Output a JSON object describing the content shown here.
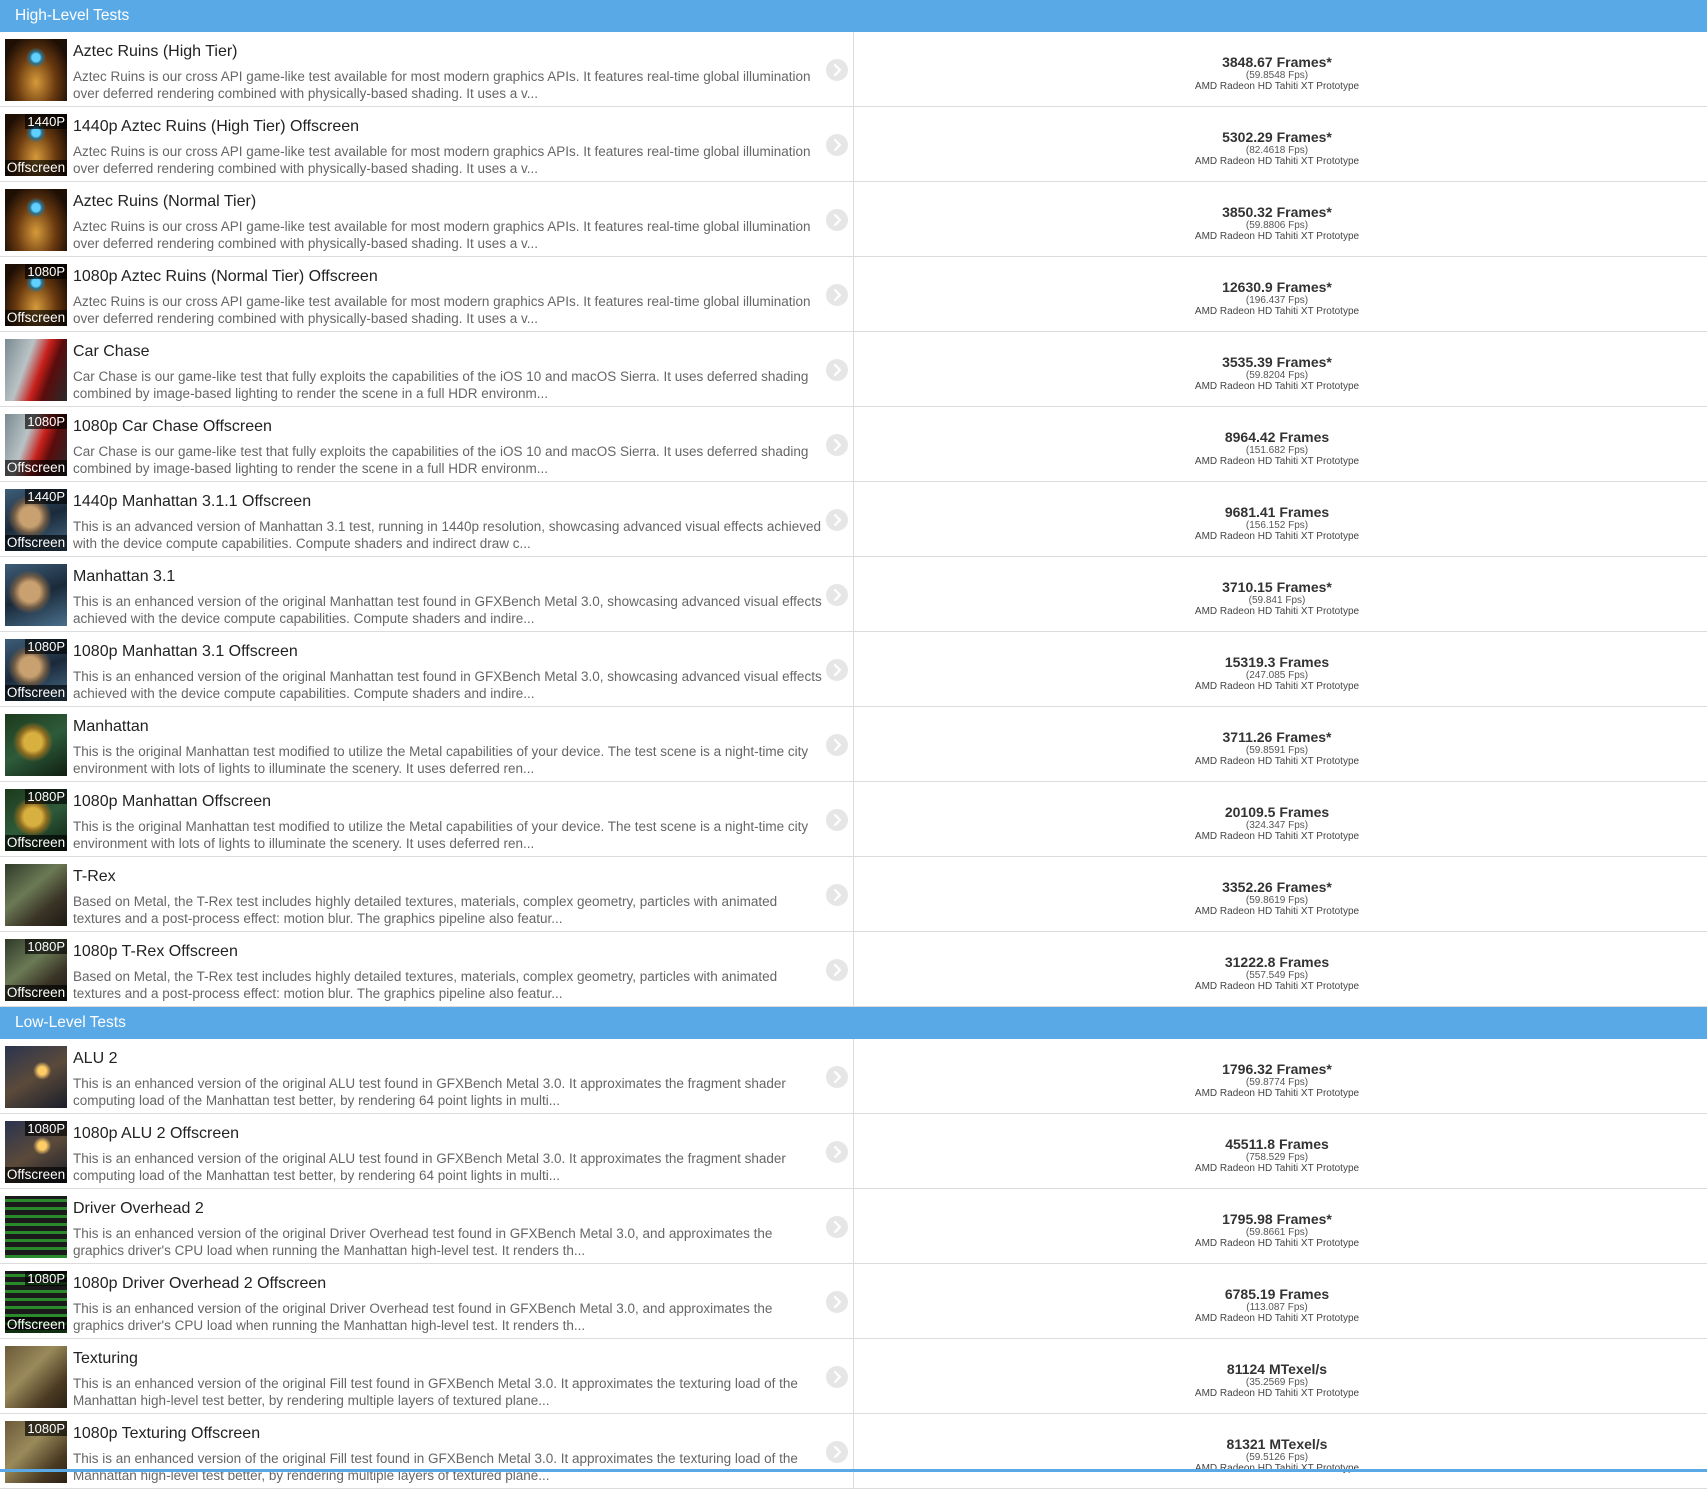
{
  "colors": {
    "header": "#58a9e6",
    "row_border": "#dcdcdc",
    "title": "#222222",
    "desc": "#666666"
  },
  "sections": [
    {
      "title": "High-Level Tests",
      "rows": [
        {
          "name": "Aztec Ruins (High Tier)",
          "thumb": "aztec",
          "badge_top": "",
          "badge_bottom": "",
          "desc": "Aztec Ruins is our cross API game-like test available for most modern graphics APIs. It features real-time global illumination over deferred rendering combined with physically-based shading. It uses a v...",
          "frames": "3848.67 Frames*",
          "fps": "(59.8548 Fps)",
          "device": "AMD Radeon HD Tahiti XT Prototype"
        },
        {
          "name": "1440p Aztec Ruins (High Tier) Offscreen",
          "thumb": "aztec",
          "badge_top": "1440P",
          "badge_bottom": "Offscreen",
          "desc": "Aztec Ruins is our cross API game-like test available for most modern graphics APIs. It features real-time global illumination over deferred rendering combined with physically-based shading. It uses a v...",
          "frames": "5302.29 Frames*",
          "fps": "(82.4618 Fps)",
          "device": "AMD Radeon HD Tahiti XT Prototype"
        },
        {
          "name": "Aztec Ruins (Normal Tier)",
          "thumb": "aztec",
          "badge_top": "",
          "badge_bottom": "",
          "desc": "Aztec Ruins is our cross API game-like test available for most modern graphics APIs. It features real-time global illumination over deferred rendering combined with physically-based shading. It uses a v...",
          "frames": "3850.32 Frames*",
          "fps": "(59.8806 Fps)",
          "device": "AMD Radeon HD Tahiti XT Prototype"
        },
        {
          "name": "1080p Aztec Ruins (Normal Tier) Offscreen",
          "thumb": "aztec",
          "badge_top": "1080P",
          "badge_bottom": "Offscreen",
          "desc": "Aztec Ruins is our cross API game-like test available for most modern graphics APIs. It features real-time global illumination over deferred rendering combined with physically-based shading. It uses a v...",
          "frames": "12630.9 Frames*",
          "fps": "(196.437 Fps)",
          "device": "AMD Radeon HD Tahiti XT Prototype"
        },
        {
          "name": "Car Chase",
          "thumb": "car",
          "badge_top": "",
          "badge_bottom": "",
          "desc": "Car Chase is our game-like test that fully exploits the capabilities of the iOS 10 and macOS Sierra. It uses deferred shading combined by image-based lighting to render the scene in a full HDR environm...",
          "frames": "3535.39 Frames*",
          "fps": "(59.8204 Fps)",
          "device": "AMD Radeon HD Tahiti XT Prototype"
        },
        {
          "name": "1080p Car Chase Offscreen",
          "thumb": "car",
          "badge_top": "1080P",
          "badge_bottom": "Offscreen",
          "desc": "Car Chase is our game-like test that fully exploits the capabilities of the iOS 10 and macOS Sierra. It uses deferred shading combined by image-based lighting to render the scene in a full HDR environm...",
          "frames": "8964.42 Frames",
          "fps": "(151.682 Fps)",
          "device": "AMD Radeon HD Tahiti XT Prototype"
        },
        {
          "name": "1440p Manhattan 3.1.1 Offscreen",
          "thumb": "manhattan31",
          "badge_top": "1440P",
          "badge_bottom": "Offscreen",
          "desc": "This is an advanced version of Manhattan 3.1 test, running in 1440p resolution, showcasing advanced visual effects achieved with the device compute capabilities. Compute shaders and indirect draw c...",
          "frames": "9681.41 Frames",
          "fps": "(156.152 Fps)",
          "device": "AMD Radeon HD Tahiti XT Prototype"
        },
        {
          "name": "Manhattan 3.1",
          "thumb": "manhattan31",
          "badge_top": "",
          "badge_bottom": "",
          "desc": "This is an enhanced version of the original Manhattan test found in GFXBench Metal 3.0, showcasing advanced visual effects achieved with the device compute capabilities. Compute shaders and indire...",
          "frames": "3710.15 Frames*",
          "fps": "(59.841 Fps)",
          "device": "AMD Radeon HD Tahiti XT Prototype"
        },
        {
          "name": "1080p Manhattan 3.1 Offscreen",
          "thumb": "manhattan31",
          "badge_top": "1080P",
          "badge_bottom": "Offscreen",
          "desc": "This is an enhanced version of the original Manhattan test found in GFXBench Metal 3.0, showcasing advanced visual effects achieved with the device compute capabilities. Compute shaders and indire...",
          "frames": "15319.3 Frames",
          "fps": "(247.085 Fps)",
          "device": "AMD Radeon HD Tahiti XT Prototype"
        },
        {
          "name": "Manhattan",
          "thumb": "manhattan",
          "badge_top": "",
          "badge_bottom": "",
          "desc": "This is the original Manhattan test modified to utilize the Metal capabilities of your device. The test scene is a night-time city environment with lots of lights to illuminate the scenery. It uses deferred ren...",
          "frames": "3711.26 Frames*",
          "fps": "(59.8591 Fps)",
          "device": "AMD Radeon HD Tahiti XT Prototype"
        },
        {
          "name": "1080p Manhattan Offscreen",
          "thumb": "manhattan",
          "badge_top": "1080P",
          "badge_bottom": "Offscreen",
          "desc": "This is the original Manhattan test modified to utilize the Metal capabilities of your device. The test scene is a night-time city environment with lots of lights to illuminate the scenery. It uses deferred ren...",
          "frames": "20109.5 Frames",
          "fps": "(324.347 Fps)",
          "device": "AMD Radeon HD Tahiti XT Prototype"
        },
        {
          "name": "T-Rex",
          "thumb": "trex",
          "badge_top": "",
          "badge_bottom": "",
          "desc": "Based on Metal, the T-Rex test includes highly detailed textures, materials, complex geometry, particles with animated textures and a post-process effect: motion blur. The graphics pipeline also featur...",
          "frames": "3352.26 Frames*",
          "fps": "(59.8619 Fps)",
          "device": "AMD Radeon HD Tahiti XT Prototype"
        },
        {
          "name": "1080p T-Rex Offscreen",
          "thumb": "trex",
          "badge_top": "1080P",
          "badge_bottom": "Offscreen",
          "desc": "Based on Metal, the T-Rex test includes highly detailed textures, materials, complex geometry, particles with animated textures and a post-process effect: motion blur. The graphics pipeline also featur...",
          "frames": "31222.8 Frames",
          "fps": "(557.549 Fps)",
          "device": "AMD Radeon HD Tahiti XT Prototype"
        }
      ]
    },
    {
      "title": "Low-Level Tests",
      "rows": [
        {
          "name": "ALU 2",
          "thumb": "alu",
          "badge_top": "",
          "badge_bottom": "",
          "desc": "This is an enhanced version of the original ALU test found in GFXBench Metal 3.0. It approximates the fragment shader computing load of the Manhattan test better, by rendering 64 point lights in multi...",
          "frames": "1796.32 Frames*",
          "fps": "(59.8774 Fps)",
          "device": "AMD Radeon HD Tahiti XT Prototype"
        },
        {
          "name": "1080p ALU 2 Offscreen",
          "thumb": "alu",
          "badge_top": "1080P",
          "badge_bottom": "Offscreen",
          "desc": "This is an enhanced version of the original ALU test found in GFXBench Metal 3.0. It approximates the fragment shader computing load of the Manhattan test better, by rendering 64 point lights in multi...",
          "frames": "45511.8 Frames",
          "fps": "(758.529 Fps)",
          "device": "AMD Radeon HD Tahiti XT Prototype"
        },
        {
          "name": "Driver Overhead 2",
          "thumb": "driver",
          "badge_top": "",
          "badge_bottom": "",
          "desc": "This is an enhanced version of the original Driver Overhead test found in GFXBench Metal 3.0, and approximates the graphics driver's CPU load when running the Manhattan high-level test. It renders th...",
          "frames": "1795.98 Frames*",
          "fps": "(59.8661 Fps)",
          "device": "AMD Radeon HD Tahiti XT Prototype"
        },
        {
          "name": "1080p Driver Overhead 2 Offscreen",
          "thumb": "driver",
          "badge_top": "1080P",
          "badge_bottom": "Offscreen",
          "desc": "This is an enhanced version of the original Driver Overhead test found in GFXBench Metal 3.0, and approximates the graphics driver's CPU load when running the Manhattan high-level test. It renders th...",
          "frames": "6785.19 Frames",
          "fps": "(113.087 Fps)",
          "device": "AMD Radeon HD Tahiti XT Prototype"
        },
        {
          "name": "Texturing",
          "thumb": "texturing",
          "badge_top": "",
          "badge_bottom": "",
          "desc": "This is an enhanced version of the original Fill test found in GFXBench Metal 3.0. It approximates the texturing load of the Manhattan high-level test better, by rendering multiple layers of textured plane...",
          "frames": "81124 MTexel/s",
          "fps": "(35.2569 Fps)",
          "device": "AMD Radeon HD Tahiti XT Prototype"
        },
        {
          "name": "1080p Texturing Offscreen",
          "thumb": "texturing",
          "badge_top": "1080P",
          "badge_bottom": "",
          "desc": "This is an enhanced version of the original Fill test found in GFXBench Metal 3.0. It approximates the texturing load of the Manhattan high-level test better, by rendering multiple layers of textured plane...",
          "frames": "81321 MTexel/s",
          "fps": "(59.5126 Fps)",
          "device": "AMD Radeon HD Tahiti XT Prototype"
        }
      ]
    }
  ]
}
